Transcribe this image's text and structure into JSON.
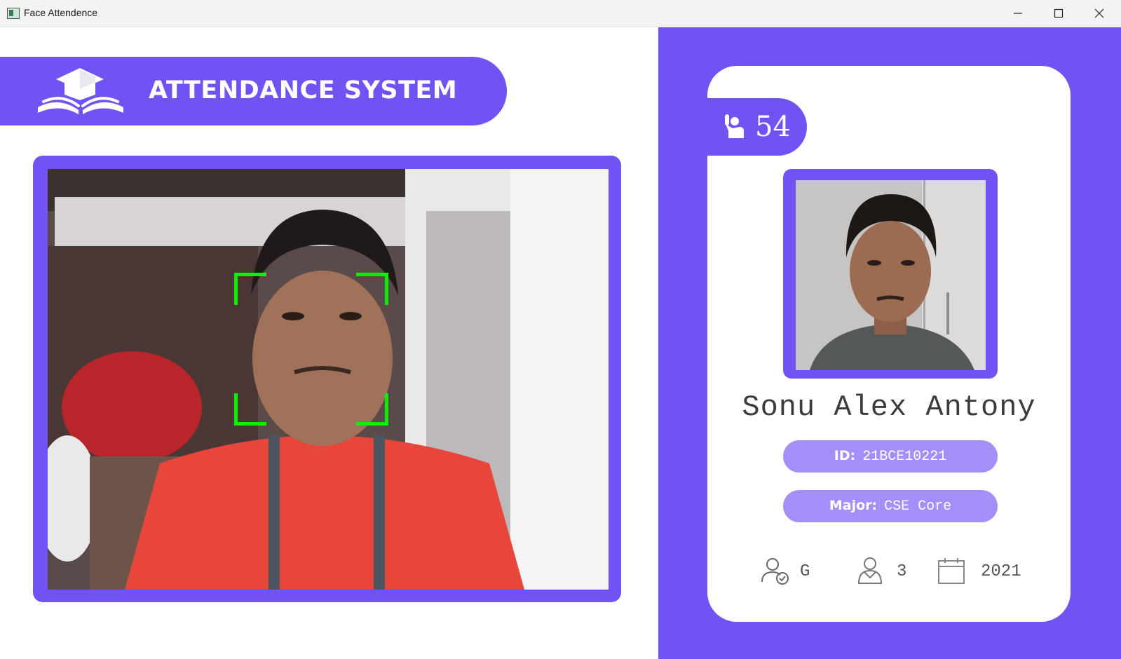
{
  "window": {
    "title": "Face Attendence"
  },
  "banner": {
    "title": "ATTENDANCE SYSTEM"
  },
  "student": {
    "total_attendance": "54",
    "name": "Sonu Alex Antony",
    "id_label": "ID:",
    "id_value": "21BCE10221",
    "major_label": "Major:",
    "major_value": "CSE Core",
    "standing": "G",
    "year": "3",
    "starting_year": "2021"
  },
  "colors": {
    "accent": "#7152f3",
    "pill": "#a68ef8",
    "detection_box": "#08f200",
    "panel_bg": "#ffffff"
  },
  "icons": {
    "banner_logo": "graduation-cap-book-icon",
    "attendance": "raised-hand-person-icon",
    "standing": "user-check-icon",
    "year": "student-person-icon",
    "starting_year": "calendar-icon"
  }
}
